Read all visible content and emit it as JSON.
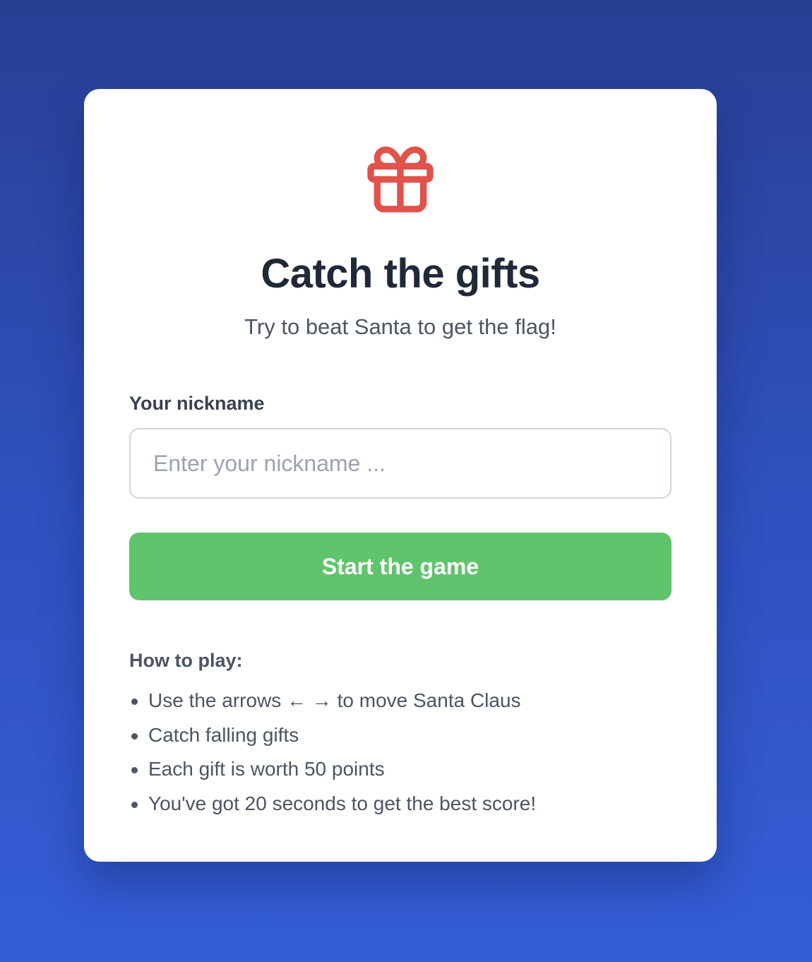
{
  "card": {
    "icon": "gift-icon",
    "icon_color": "#e0524a",
    "title": "Catch the gifts",
    "subtitle": "Try to beat Santa to get the flag!"
  },
  "form": {
    "nickname_label": "Your nickname",
    "nickname_placeholder": "Enter your nickname ...",
    "nickname_value": "",
    "start_label": "Start the game",
    "start_color": "#5fc46c"
  },
  "howto": {
    "heading": "How to play:",
    "rules": [
      "Use the arrows ← → to move Santa Claus",
      "Catch falling gifts",
      "Each gift is worth 50 points",
      "You've got 20 seconds to get the best score!"
    ]
  },
  "colors": {
    "background_top": "#283f93",
    "background_bottom": "#345dd6",
    "title_text": "#1f2937",
    "body_text": "#4b5563"
  }
}
